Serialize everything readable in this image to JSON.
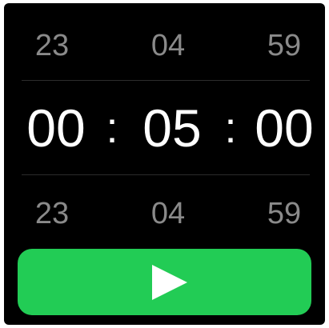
{
  "timer": {
    "above": {
      "hours": "23",
      "minutes": "04",
      "seconds": "59"
    },
    "selected": {
      "hours": "00",
      "minutes": "05",
      "seconds": "00",
      "separator": ":"
    },
    "below": {
      "hours": "23",
      "minutes": "04",
      "seconds": "59"
    }
  },
  "start_button": {
    "icon": "play-icon",
    "color": "#22cc55"
  },
  "colors": {
    "background": "#000000",
    "faded_text": "#8a8a8a",
    "active_text": "#ffffff"
  }
}
